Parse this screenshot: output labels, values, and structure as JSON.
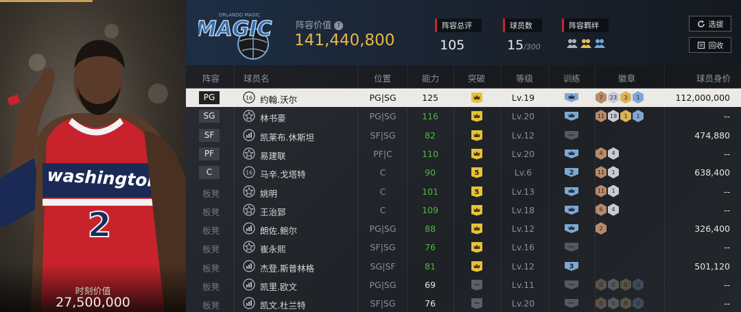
{
  "moment": {
    "label": "时刻价值",
    "value": "27,500,000"
  },
  "team": {
    "logo_text": "MAGIC",
    "logo_subtext": "ORLANDO MAGIC"
  },
  "header": {
    "value_label": "阵容价值",
    "value_amount": "141,440,800",
    "rating_label": "阵容总评",
    "rating_value": "105",
    "count_label": "球员数",
    "count_value": "15",
    "count_max": "/300",
    "bond_label": "阵容羁绊",
    "select_label": "选拔",
    "back_label": "回收"
  },
  "columns": {
    "pos": "阵容",
    "name": "球员名",
    "position": "位置",
    "ability": "能力",
    "breakthrough": "突破",
    "level": "等级",
    "training": "训练",
    "badges": "徽章",
    "value": "球员身价"
  },
  "rows": [
    {
      "pos": "PG",
      "bench": false,
      "icon": "number-16",
      "name": "约翰.沃尔",
      "position": "PG|SG",
      "ability": "125",
      "ability_color": "white",
      "brk": "crown-gold",
      "level": "Lv.19",
      "train": "crown",
      "badges": [
        {
          "t": "7",
          "c": "#b88a6a"
        },
        {
          "t": "23",
          "c": "#c8ccd2"
        },
        {
          "t": "3",
          "c": "#d9b25a"
        },
        {
          "t": "1",
          "c": "#7fa6d6"
        }
      ],
      "value": "112,000,000",
      "selected": true
    },
    {
      "pos": "SG",
      "bench": false,
      "icon": "star",
      "name": "林书豪",
      "position": "PG|SG",
      "ability": "116",
      "ability_color": "green",
      "brk": "crown-gold",
      "level": "Lv.20",
      "train": "crown",
      "badges": [
        {
          "t": "11",
          "c": "#b88a6a"
        },
        {
          "t": "19",
          "c": "#c8ccd2"
        },
        {
          "t": "1",
          "c": "#d9b25a"
        },
        {
          "t": "1",
          "c": "#7fa6d6"
        }
      ],
      "value": "--"
    },
    {
      "pos": "SF",
      "bench": false,
      "icon": "bars",
      "name": "凯莱布.休斯坦",
      "position": "SF|SG",
      "ability": "82",
      "ability_color": "green",
      "brk": "crown-gold",
      "level": "Lv.12",
      "train": "empty",
      "badges": [],
      "value": "474,880"
    },
    {
      "pos": "PF",
      "bench": false,
      "icon": "star",
      "name": "易建联",
      "position": "PF|C",
      "ability": "110",
      "ability_color": "green",
      "brk": "crown-gold",
      "level": "Lv.20",
      "train": "crown",
      "badges": [
        {
          "t": "4",
          "c": "#b88a6a"
        },
        {
          "t": "4",
          "c": "#c8ccd2"
        }
      ],
      "value": "--"
    },
    {
      "pos": "C",
      "bench": false,
      "icon": "number-16",
      "name": "马辛.戈塔特",
      "position": "C",
      "ability": "90",
      "ability_color": "green",
      "brk": "num-5",
      "level": "Lv.6",
      "train": "num-2",
      "badges": [
        {
          "t": "11",
          "c": "#b88a6a"
        },
        {
          "t": "1",
          "c": "#c8ccd2"
        }
      ],
      "value": "638,400"
    },
    {
      "pos": "板凳",
      "bench": true,
      "icon": "star",
      "name": "姚明",
      "position": "C",
      "ability": "101",
      "ability_color": "green",
      "brk": "num-5",
      "level": "Lv.13",
      "train": "crown",
      "badges": [
        {
          "t": "11",
          "c": "#b88a6a"
        },
        {
          "t": "1",
          "c": "#c8ccd2"
        }
      ],
      "value": "--"
    },
    {
      "pos": "板凳",
      "bench": true,
      "icon": "star",
      "name": "王治郅",
      "position": "C",
      "ability": "109",
      "ability_color": "green",
      "brk": "crown-gold",
      "level": "Lv.18",
      "train": "crown",
      "badges": [
        {
          "t": "6",
          "c": "#b88a6a"
        },
        {
          "t": "4",
          "c": "#c8ccd2"
        }
      ],
      "value": "--"
    },
    {
      "pos": "板凳",
      "bench": true,
      "icon": "bars",
      "name": "朗佐.鲍尔",
      "position": "PG|SG",
      "ability": "88",
      "ability_color": "green",
      "brk": "crown-gold",
      "level": "Lv.12",
      "train": "crown",
      "badges": [
        {
          "t": "2",
          "c": "#b88a6a"
        }
      ],
      "value": "326,400"
    },
    {
      "pos": "板凳",
      "bench": true,
      "icon": "star",
      "name": "崔永熙",
      "position": "SF|SG",
      "ability": "76",
      "ability_color": "green",
      "brk": "crown-gold",
      "level": "Lv.16",
      "train": "empty",
      "badges": [],
      "value": "--"
    },
    {
      "pos": "板凳",
      "bench": true,
      "icon": "bars",
      "name": "杰登.斯普林格",
      "position": "SG|SF",
      "ability": "81",
      "ability_color": "green",
      "brk": "crown-gold",
      "level": "Lv.12",
      "train": "num-3",
      "badges": [],
      "value": "501,120"
    },
    {
      "pos": "板凳",
      "bench": true,
      "icon": "bars",
      "name": "凯里.欧文",
      "position": "PG|SG",
      "ability": "69",
      "ability_color": "white",
      "brk": "empty",
      "level": "Lv.11",
      "train": "empty",
      "badges": [
        {
          "t": "0",
          "c": "#5b5148"
        },
        {
          "t": "0",
          "c": "#55585c"
        },
        {
          "t": "0",
          "c": "#5a5140"
        },
        {
          "t": "0",
          "c": "#3c4a5c"
        }
      ],
      "value": "--"
    },
    {
      "pos": "板凳",
      "bench": true,
      "icon": "bars",
      "name": "凯文.杜兰特",
      "position": "SF|SG",
      "ability": "76",
      "ability_color": "white",
      "brk": "empty",
      "level": "Lv.20",
      "train": "empty",
      "badges": [
        {
          "t": "0",
          "c": "#5b5148"
        },
        {
          "t": "0",
          "c": "#55585c"
        },
        {
          "t": "0",
          "c": "#5a5140"
        },
        {
          "t": "0",
          "c": "#3c4a5c"
        }
      ],
      "value": "--"
    }
  ]
}
